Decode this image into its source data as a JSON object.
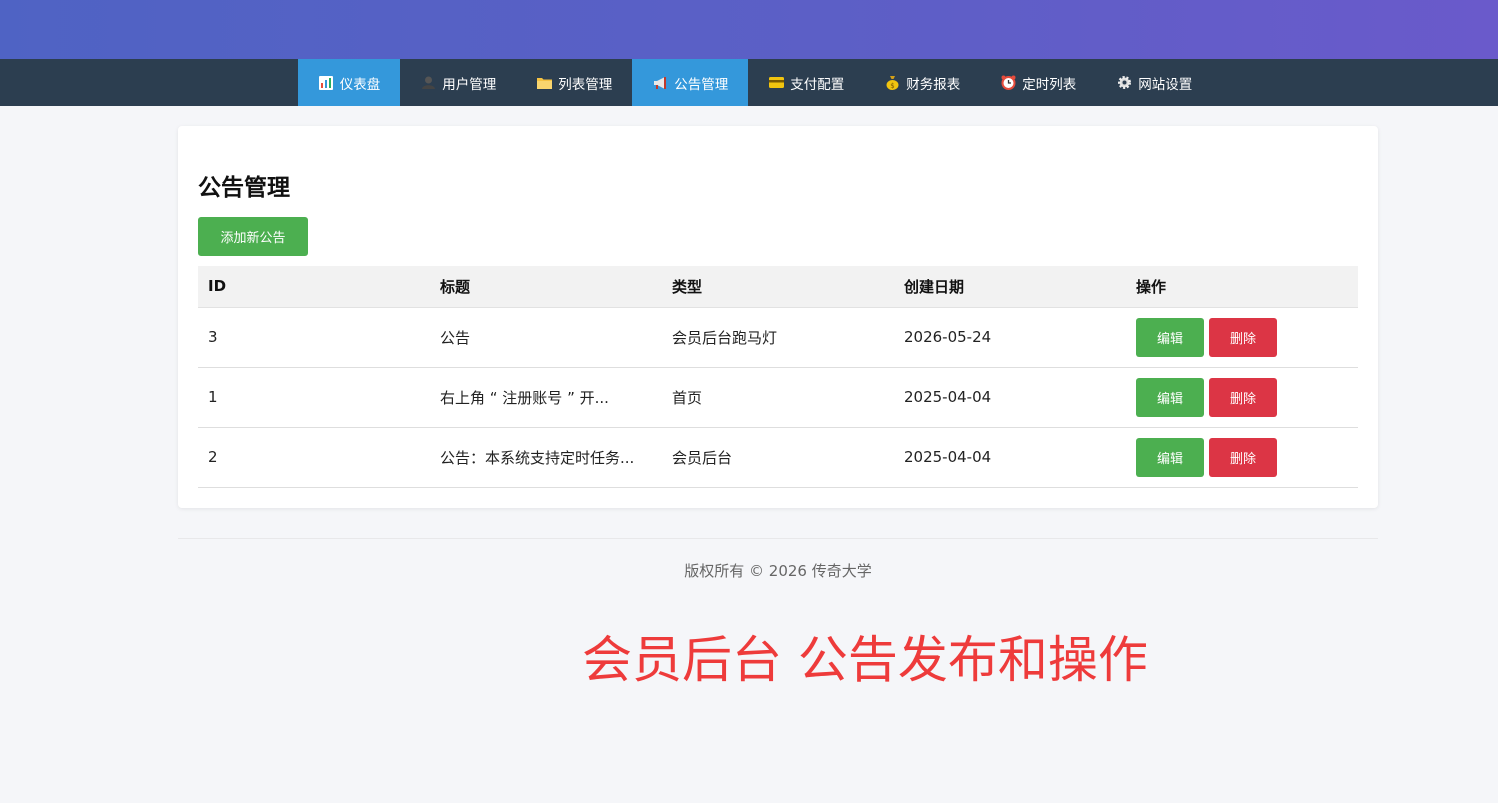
{
  "nav": {
    "items": [
      {
        "label": "仪表盘",
        "icon": "bar-chart-icon"
      },
      {
        "label": "用户管理",
        "icon": "user-icon"
      },
      {
        "label": "列表管理",
        "icon": "folder-icon"
      },
      {
        "label": "公告管理",
        "icon": "megaphone-icon"
      },
      {
        "label": "支付配置",
        "icon": "credit-card-icon"
      },
      {
        "label": "财务报表",
        "icon": "money-bag-icon"
      },
      {
        "label": "定时列表",
        "icon": "alarm-clock-icon"
      },
      {
        "label": "网站设置",
        "icon": "gear-icon"
      }
    ],
    "active_index": 0
  },
  "main": {
    "title": "公告管理",
    "add_button": "添加新公告",
    "table": {
      "headers": [
        "ID",
        "标题",
        "类型",
        "创建日期",
        "操作"
      ],
      "rows": [
        {
          "id": "3",
          "title": "公告",
          "type": "会员后台跑马灯",
          "date": "2026-05-24",
          "edit": "编辑",
          "delete": "删除"
        },
        {
          "id": "1",
          "title": "右上角 “ 注册账号 ” 开...",
          "type": "首页",
          "date": "2025-04-04",
          "edit": "编辑",
          "delete": "删除"
        },
        {
          "id": "2",
          "title": "公告：本系统支持定时任务...",
          "type": "会员后台",
          "date": "2025-04-04",
          "edit": "编辑",
          "delete": "删除"
        }
      ]
    }
  },
  "footer": {
    "copyright": "版权所有 © 2026 传奇大学"
  },
  "overlay": {
    "caption": "会员后台 公告发布和操作"
  },
  "colors": {
    "nav_bg": "#2c3e50",
    "nav_active": "#3498db",
    "edit_button": "#4caf50",
    "delete_button": "#dc3545",
    "caption": "#ee3b3b"
  }
}
